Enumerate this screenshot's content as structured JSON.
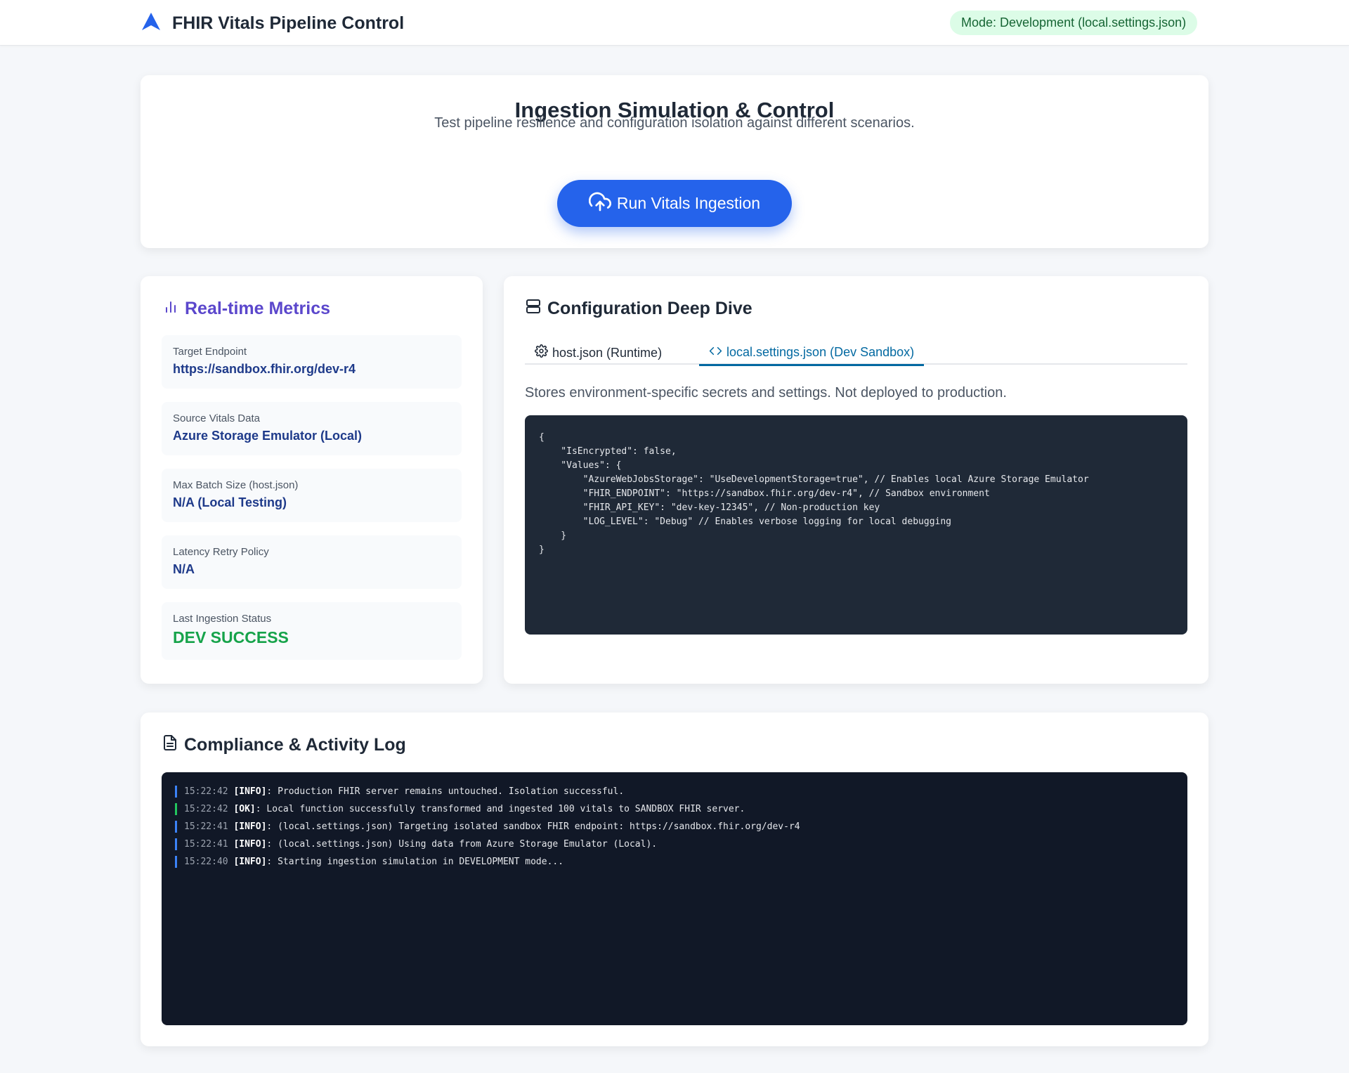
{
  "header": {
    "title": "FHIR Vitals Pipeline Control",
    "mode_badge": "Mode: Development (local.settings.json)",
    "logo_icon": "navigation-arrow-icon",
    "accent_color": "#2563eb"
  },
  "hero": {
    "title": "Ingestion Simulation & Control",
    "subtitle": "Test pipeline resilience and configuration isolation against different scenarios.",
    "run_button": "Run Vitals Ingestion",
    "run_icon": "upload-cloud-icon"
  },
  "metrics": {
    "title": "Real-time Metrics",
    "title_icon": "bar-chart-icon",
    "items": [
      {
        "label": "Target Endpoint",
        "value": "https://sandbox.fhir.org/dev-r4"
      },
      {
        "label": "Source Vitals Data",
        "value": "Azure Storage Emulator (Local)"
      },
      {
        "label": "Max Batch Size (host.json)",
        "value": "N/A (Local Testing)"
      },
      {
        "label": "Latency Retry Policy",
        "value": "N/A"
      },
      {
        "label": "Last Ingestion Status",
        "value": "DEV SUCCESS"
      }
    ],
    "success_color": "#16a34a"
  },
  "config": {
    "title": "Configuration Deep Dive",
    "title_icon": "server-icon",
    "tabs": [
      {
        "label": "host.json (Runtime)",
        "icon": "gear-icon",
        "active": false
      },
      {
        "label": "local.settings.json (Dev Sandbox)",
        "icon": "code-icon",
        "active": true
      }
    ],
    "description": "Stores environment-specific secrets and settings. Not deployed to production.",
    "code": "{\n    \"IsEncrypted\": false,\n    \"Values\": {\n        \"AzureWebJobsStorage\": \"UseDevelopmentStorage=true\", // Enables local Azure Storage Emulator\n        \"FHIR_ENDPOINT\": \"https://sandbox.fhir.org/dev-r4\", // Sandbox environment\n        \"FHIR_API_KEY\": \"dev-key-12345\", // Non-production key\n        \"LOG_LEVEL\": \"Debug\" // Enables verbose logging for local debugging\n    }\n}"
  },
  "log": {
    "title": "Compliance & Activity Log",
    "title_icon": "document-icon",
    "entries": [
      {
        "time": "15:22:42",
        "level": "[INFO]",
        "message": ": Production FHIR server remains untouched. Isolation successful."
      },
      {
        "time": "15:22:42",
        "level": "[OK]",
        "message": ": Local function successfully transformed and ingested 100 vitals to SANDBOX FHIR server."
      },
      {
        "time": "15:22:41",
        "level": "[INFO]",
        "message": ": (local.settings.json) Targeting isolated sandbox FHIR endpoint: https://sandbox.fhir.org/dev-r4"
      },
      {
        "time": "15:22:41",
        "level": "[INFO]",
        "message": ": (local.settings.json) Using data from Azure Storage Emulator (Local)."
      },
      {
        "time": "15:22:40",
        "level": "[INFO]",
        "message": ": Starting ingestion simulation in DEVELOPMENT mode..."
      }
    ]
  }
}
